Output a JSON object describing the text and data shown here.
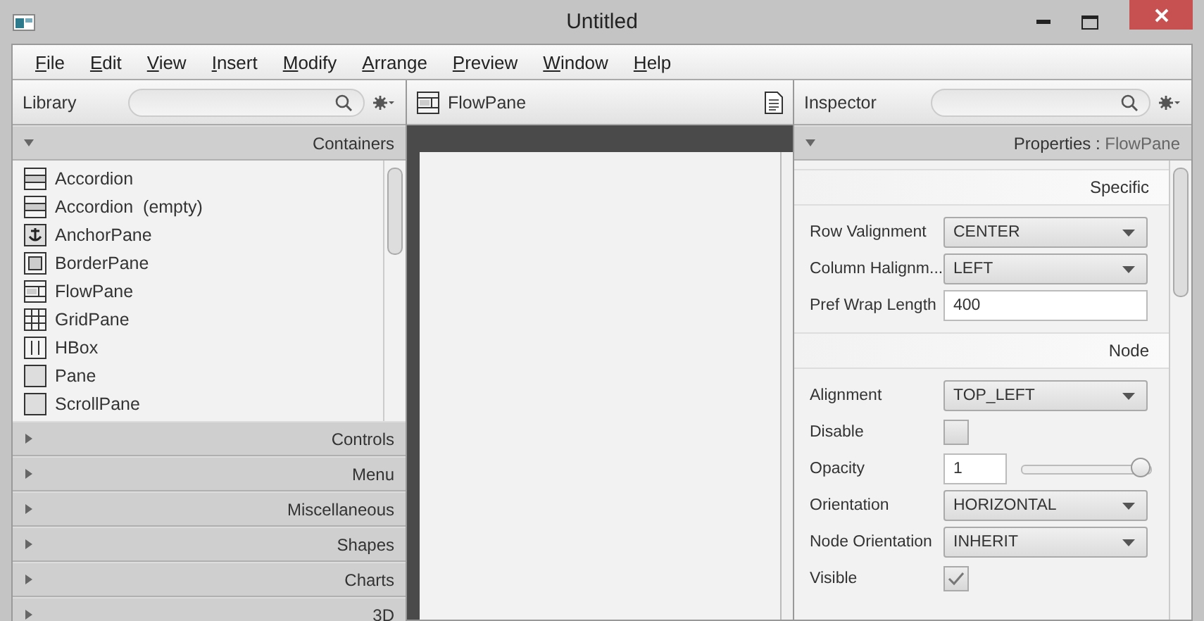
{
  "window": {
    "title": "Untitled"
  },
  "menu": [
    "File",
    "Edit",
    "View",
    "Insert",
    "Modify",
    "Arrange",
    "Preview",
    "Window",
    "Help"
  ],
  "library": {
    "title": "Library",
    "sections": [
      {
        "label": "Containers",
        "expanded": true,
        "items": [
          {
            "label": "Accordion",
            "kind": "accordion"
          },
          {
            "label": "Accordion  (empty)",
            "kind": "accordion"
          },
          {
            "label": "AnchorPane",
            "kind": "anchor"
          },
          {
            "label": "BorderPane",
            "kind": "border"
          },
          {
            "label": "FlowPane",
            "kind": "flow"
          },
          {
            "label": "GridPane",
            "kind": "grid"
          },
          {
            "label": "HBox",
            "kind": "hbox"
          },
          {
            "label": "Pane",
            "kind": "pane"
          },
          {
            "label": "ScrollPane",
            "kind": "pane"
          }
        ]
      },
      {
        "label": "Controls",
        "expanded": false
      },
      {
        "label": "Menu",
        "expanded": false
      },
      {
        "label": "Miscellaneous",
        "expanded": false
      },
      {
        "label": "Shapes",
        "expanded": false
      },
      {
        "label": "Charts",
        "expanded": false
      },
      {
        "label": "3D",
        "expanded": false
      }
    ]
  },
  "document": {
    "title": "FlowPane"
  },
  "inspector": {
    "title": "Inspector",
    "section": {
      "label": "Properties",
      "separator": ":",
      "target": "FlowPane",
      "expanded": true
    },
    "groups": [
      {
        "label": "Specific",
        "rows": [
          {
            "label": "Row Valignment",
            "kind": "select",
            "value": "CENTER"
          },
          {
            "label": "Column Halignm...",
            "kind": "select",
            "value": "LEFT"
          },
          {
            "label": "Pref Wrap Length",
            "kind": "text",
            "value": "400"
          }
        ]
      },
      {
        "label": "Node",
        "rows": [
          {
            "label": "Alignment",
            "kind": "select",
            "value": "TOP_LEFT"
          },
          {
            "label": "Disable",
            "kind": "checkbox",
            "checked": false
          },
          {
            "label": "Opacity",
            "kind": "slider",
            "value": "1",
            "level": 1
          },
          {
            "label": "Orientation",
            "kind": "select",
            "value": "HORIZONTAL"
          },
          {
            "label": "Node Orientation",
            "kind": "select",
            "value": "INHERIT"
          },
          {
            "label": "Visible",
            "kind": "checkbox",
            "checked": true
          }
        ]
      }
    ]
  }
}
